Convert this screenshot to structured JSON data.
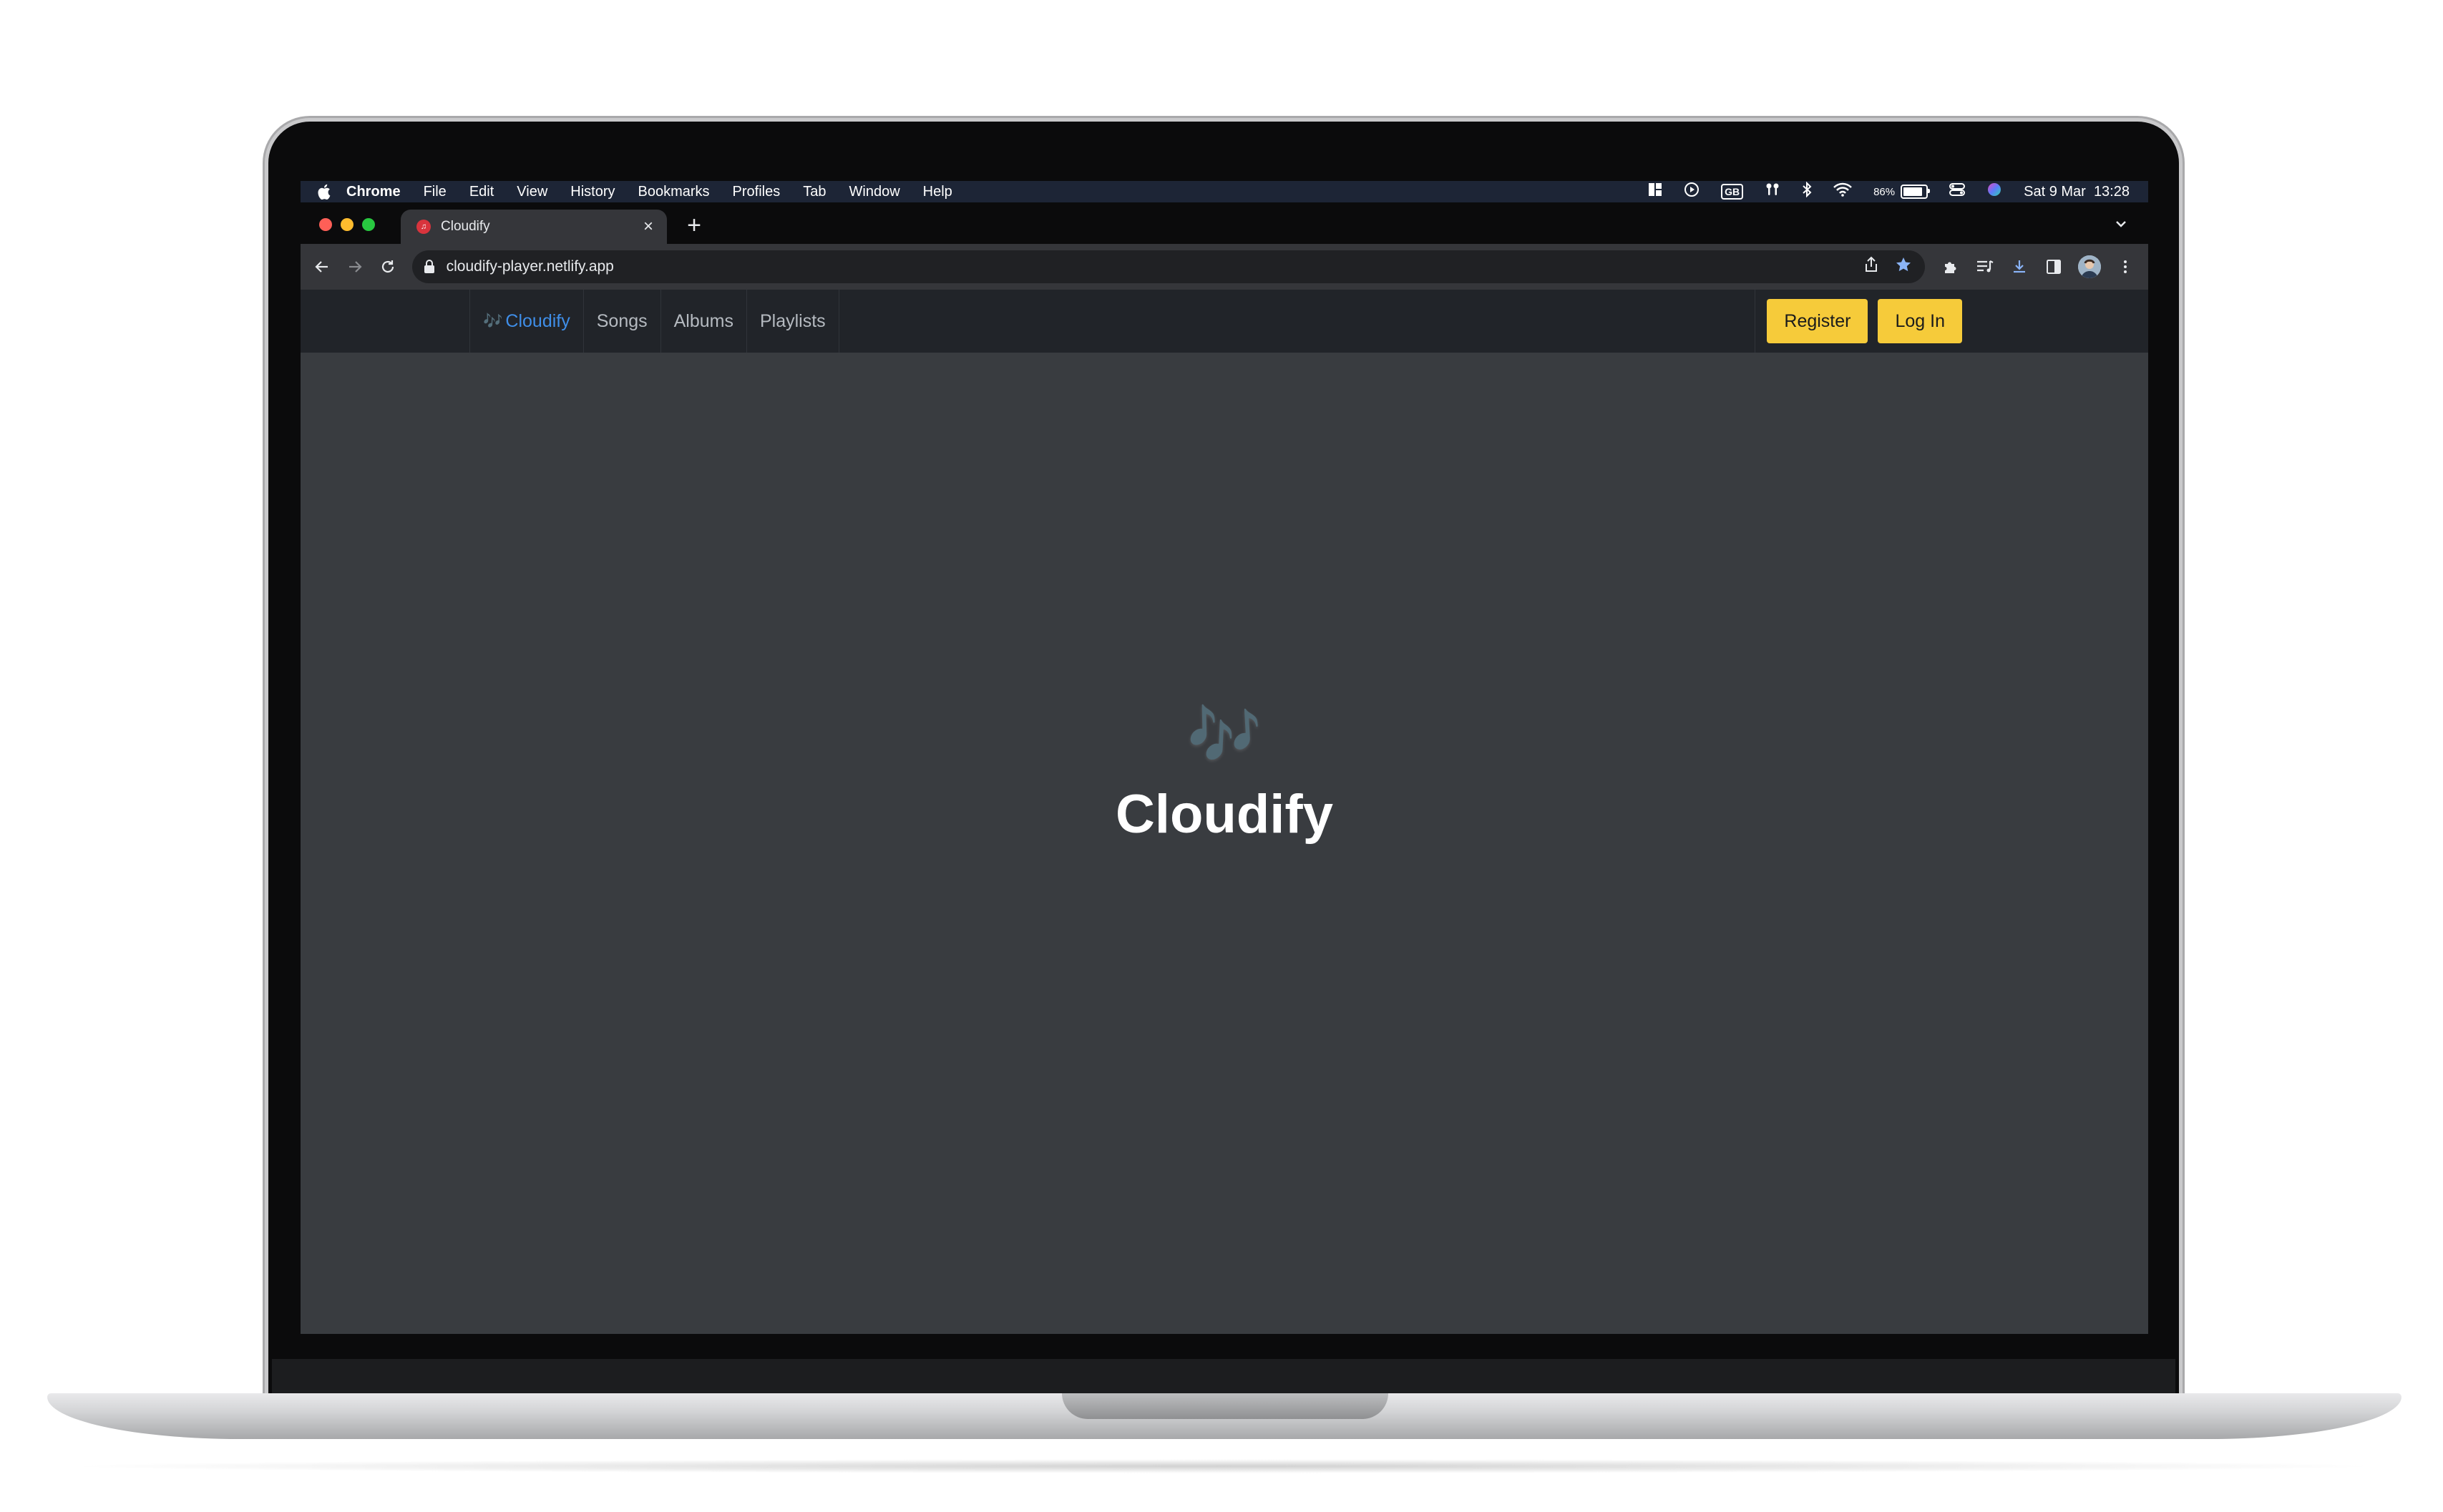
{
  "menubar": {
    "app_name": "Chrome",
    "items": [
      "File",
      "Edit",
      "View",
      "History",
      "Bookmarks",
      "Profiles",
      "Tab",
      "Window",
      "Help"
    ],
    "keyboard_layout": "GB",
    "battery_percent": "86%",
    "battery_level": 0.86,
    "datetime": "Sat 9 Mar  13:28"
  },
  "browser": {
    "tab_title": "Cloudify",
    "url": "cloudify-player.netlify.app",
    "traffic_colors": [
      "#ff5f57",
      "#febc2e",
      "#28c840"
    ],
    "accent_star_color": "#8ab4f8"
  },
  "site": {
    "brand": "Cloudify",
    "brand_icon": "🎶",
    "nav": [
      "Songs",
      "Albums",
      "Playlists"
    ],
    "register_label": "Register",
    "login_label": "Log In",
    "hero_icon": "🎶",
    "hero_title": "Cloudify",
    "button_color": "#f6cb3a",
    "brand_color": "#3f8ee8"
  }
}
